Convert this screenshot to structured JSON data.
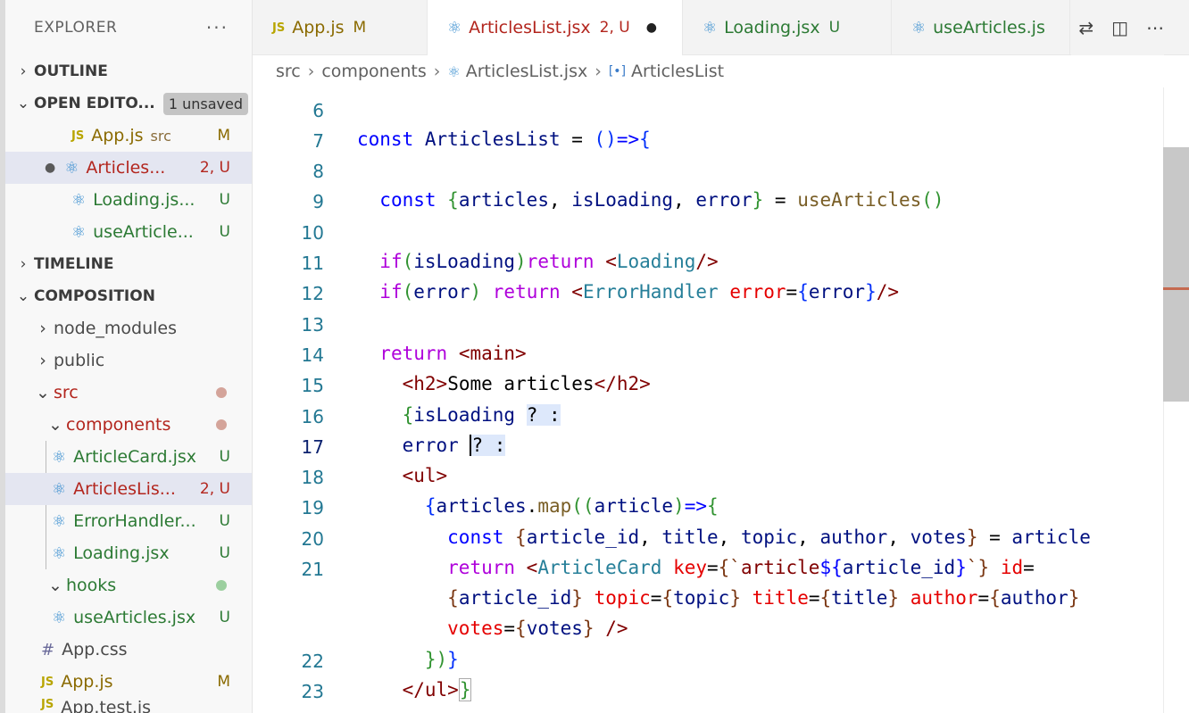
{
  "explorer": {
    "title": "EXPLORER",
    "more": "···",
    "sections": {
      "outline": "OUTLINE",
      "open_editors": "OPEN EDITO...",
      "unsaved_badge": "1 unsaved",
      "timeline": "TIMELINE",
      "composition": "COMPOSITION"
    },
    "open_editors": [
      {
        "name": "App.js",
        "extra": "src",
        "status": "M"
      },
      {
        "name": "Articles...",
        "status": "2, U"
      },
      {
        "name": "Loading.js...",
        "status": "U"
      },
      {
        "name": "useArticle...",
        "status": "U"
      }
    ],
    "tree": {
      "node_modules": "node_modules",
      "public": "public",
      "src": "src",
      "components": "components",
      "component_files": [
        {
          "name": "ArticleCard.jsx",
          "status": "U"
        },
        {
          "name": "ArticlesLis...",
          "status": "2, U"
        },
        {
          "name": "ErrorHandler...",
          "status": "U"
        },
        {
          "name": "Loading.jsx",
          "status": "U"
        }
      ],
      "hooks": "hooks",
      "hook_files": [
        {
          "name": "useArticles.jsx",
          "status": "U"
        }
      ],
      "root_files": [
        {
          "name": "App.css",
          "status": ""
        },
        {
          "name": "App.js",
          "status": "M"
        },
        {
          "name": "App.test.js",
          "status": ""
        }
      ]
    }
  },
  "tabs": [
    {
      "name": "App.js",
      "status": "M"
    },
    {
      "name": "ArticlesList.jsx",
      "status": "2, U"
    },
    {
      "name": "Loading.jsx",
      "status": "U"
    },
    {
      "name": "useArticles.js",
      "status": ""
    }
  ],
  "breadcrumb": {
    "parts": [
      "src",
      "components",
      "ArticlesList.jsx",
      "ArticlesList"
    ]
  },
  "code": {
    "line_numbers": [
      "6",
      "7",
      "8",
      "9",
      "10",
      "11",
      "12",
      "13",
      "14",
      "15",
      "16",
      "17",
      "18",
      "19",
      "20",
      "21",
      "22",
      "23"
    ],
    "l7": {
      "kw": "const",
      "name": "ArticlesList",
      "rest": " = ",
      "paren": "()",
      "arrow": "=>",
      "brace": "{"
    },
    "l9": {
      "kw": "const",
      "open": "{",
      "a": "articles",
      "b": "isLoading",
      "c": "error",
      "close": "}",
      "eq": " = ",
      "fn": "useArticles",
      "call": "()"
    },
    "l11": {
      "kw": "if",
      "cond": "isLoading",
      "ret": "return",
      "tag": "Loading"
    },
    "l12": {
      "kw": "if",
      "cond": "error",
      "ret": "return",
      "tag": "ErrorHandler",
      "attr": "error",
      "val": "error"
    },
    "l14": {
      "ret": "return",
      "tag": "main"
    },
    "l15": {
      "tag": "h2",
      "text": "Some articles"
    },
    "l16": {
      "var": "isLoading",
      "ops": "? :"
    },
    "l17": {
      "var": "error",
      "ops": "? :"
    },
    "l18": {
      "tag": "ul"
    },
    "l19": {
      "var": "articles",
      "fn": "map",
      "param": "article"
    },
    "l20": {
      "kw": "const",
      "a": "article_id",
      "b": "title",
      "c": "topic",
      "d": "author",
      "e": "votes",
      "src": "article"
    },
    "l21a": {
      "ret": "return",
      "cmp": "ArticleCard",
      "key": "key",
      "tpl_a": "article",
      "tpl_var": "article_id",
      "id": "id"
    },
    "l21b": {
      "v1": "article_id",
      "a2": "topic",
      "v2": "topic",
      "a3": "title",
      "v3": "title",
      "a4": "author",
      "v4": "author"
    },
    "l21c": {
      "a5": "votes",
      "v5": "votes"
    },
    "l23": {
      "tag": "ul"
    }
  }
}
